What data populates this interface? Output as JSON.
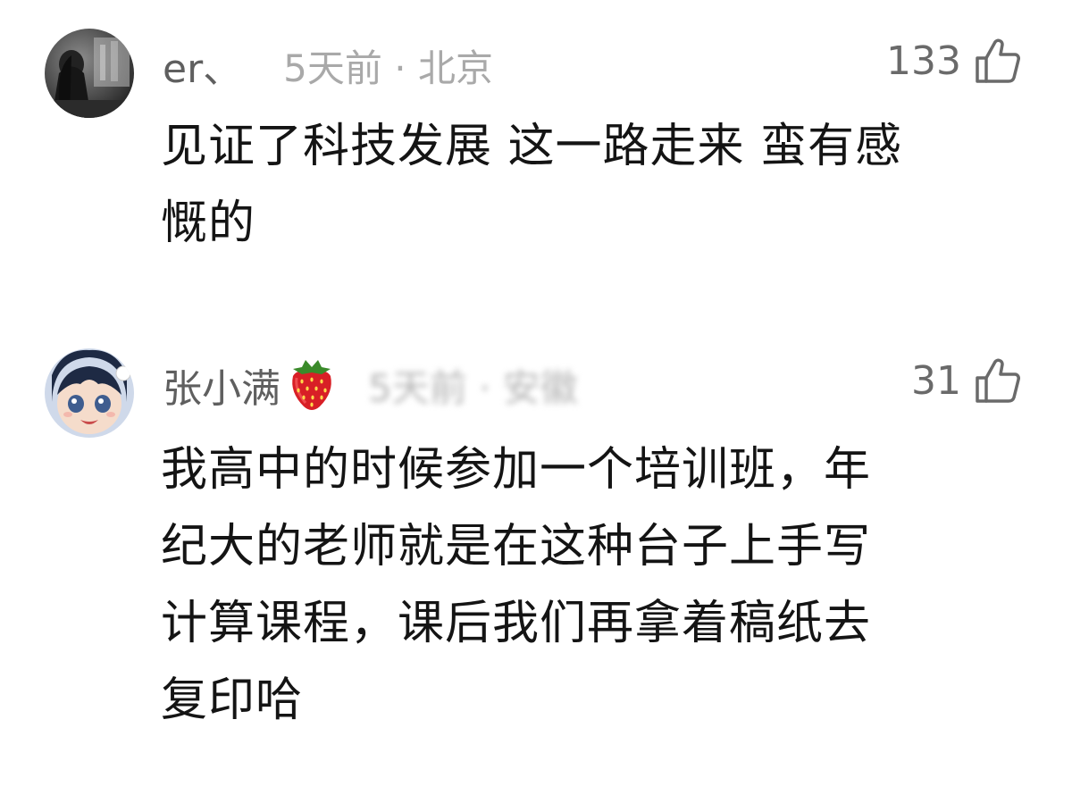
{
  "comments": [
    {
      "username": "er、",
      "time_location": "5天前 · 北京",
      "likes": "133",
      "avatar_icon": "avatar-dark-photo",
      "text": "见证了科技发展 这一路走来 蛮有感\n慨的"
    },
    {
      "username": "张小满",
      "badge_icon": "strawberry-icon",
      "time_location_blurred": "5天前 · 安徽",
      "likes": "31",
      "avatar_icon": "avatar-anime-girl",
      "text": "我高中的时候参加一个培训班，年\n纪大的老师就是在这种台子上手写\n计算课程，课后我们再拿着稿纸去\n复印哈"
    }
  ],
  "colors": {
    "username": "#5f5f5f",
    "meta": "#a9a9a9",
    "text": "#141414",
    "like": "#6a6a6a"
  }
}
